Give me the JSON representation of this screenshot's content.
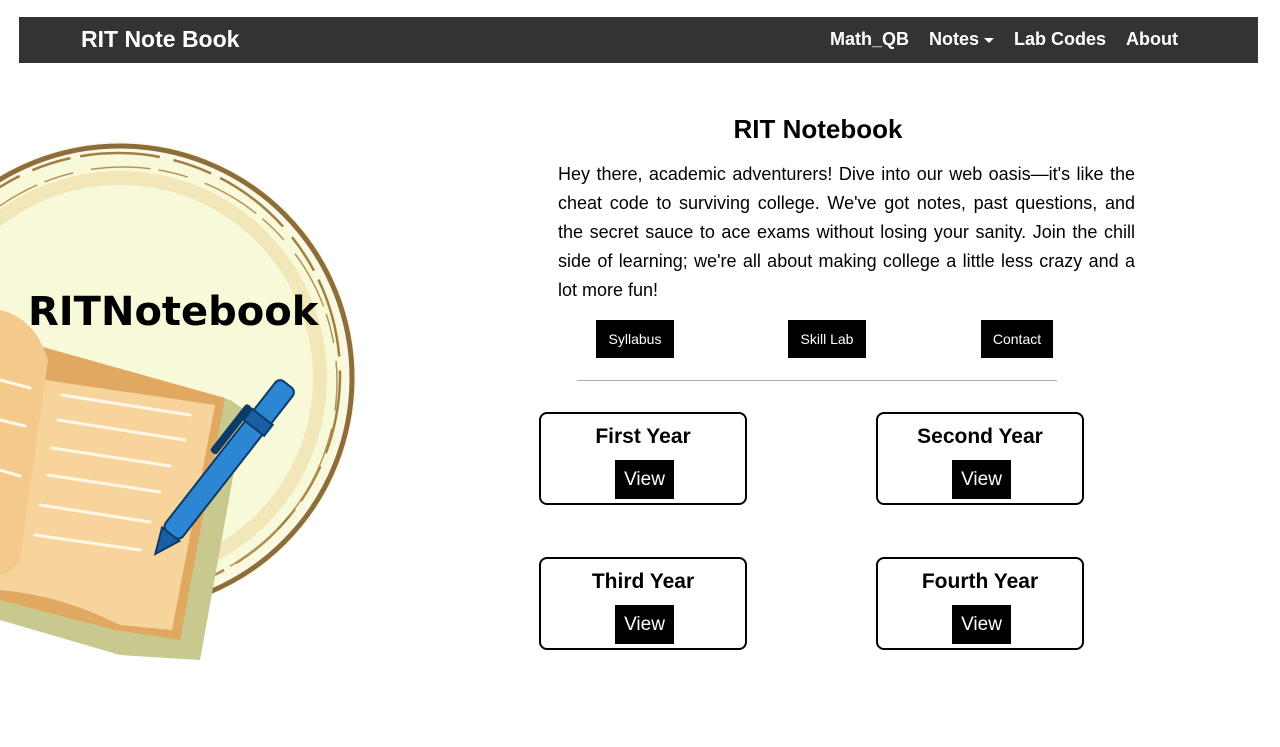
{
  "navbar": {
    "brand": "RIT Note Book",
    "links": [
      {
        "label": "Math_QB"
      },
      {
        "label": "Notes"
      },
      {
        "label": "Lab Codes"
      },
      {
        "label": "About"
      }
    ]
  },
  "hero": {
    "logo_text": "RITNotebook",
    "icon": "open-book-with-pen"
  },
  "main": {
    "title": "RIT Notebook",
    "intro": "Hey there, academic adventurers! Dive into our web oasis—it's like the cheat code to surviving college. We've got notes, past questions, and the secret sauce to ace exams without losing your sanity. Join the chill side of learning; we're all about making college a little less crazy and a lot more fun!",
    "quick_buttons": [
      {
        "label": "Syllabus"
      },
      {
        "label": "Skill Lab"
      },
      {
        "label": "Contact"
      }
    ],
    "years": [
      {
        "title": "First Year",
        "button": "View"
      },
      {
        "title": "Second Year",
        "button": "View"
      },
      {
        "title": "Third Year",
        "button": "View"
      },
      {
        "title": "Fourth Year",
        "button": "View"
      }
    ]
  },
  "colors": {
    "navbar_bg": "#333333",
    "button_bg": "#000000",
    "circle_fill": "#f8f9d9",
    "circle_ring": "#8d6e3a",
    "book_page": "#f6d49c",
    "pen": "#2d86d4"
  }
}
